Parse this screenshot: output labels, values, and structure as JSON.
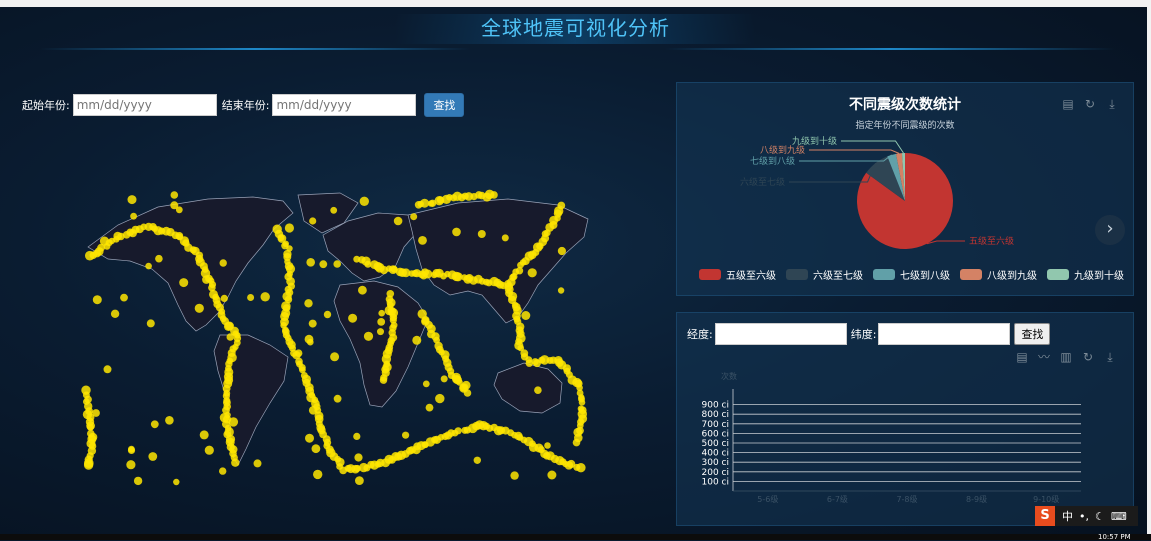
{
  "page": {
    "title": "全球地震可视化分析"
  },
  "date_filter": {
    "start_label": "起始年份:",
    "start_placeholder": "mm/dd/yyyy",
    "end_label": "结束年份:",
    "end_placeholder": "mm/dd/yyyy",
    "search_label": "查找"
  },
  "pie_panel": {
    "title": "不同震级次数统计",
    "subtitle": "指定年份不同震级的次数",
    "tools": [
      "data-view-icon",
      "refresh-icon",
      "download-icon"
    ],
    "next_label": "›"
  },
  "chart_data": [
    {
      "type": "pie",
      "title": "不同震级次数统计",
      "subtitle": "指定年份不同震级的次数",
      "categories": [
        "五级至六级",
        "六级至七级",
        "七级到八级",
        "八级到九级",
        "九级到十级"
      ],
      "values": [
        85,
        9,
        3,
        2,
        1
      ],
      "colors": [
        "#c23531",
        "#2f4554",
        "#61a0a8",
        "#d48265",
        "#91c7ae"
      ],
      "legend_position": "bottom"
    },
    {
      "type": "bar",
      "categories": [
        "5-6级",
        "6-7级",
        "7-8级",
        "8-9级",
        "9-10级"
      ],
      "values": [],
      "ylabel": "次数",
      "y_ticks": [
        "100 ci",
        "200 ci",
        "300 ci",
        "400 ci",
        "500 ci",
        "600 ci",
        "700 ci",
        "800 ci",
        "900 ci"
      ],
      "ylim": [
        0,
        1000
      ],
      "grid": true
    }
  ],
  "coord_panel": {
    "lng_label": "经度:",
    "lat_label": "纬度:",
    "search_label": "查找",
    "tools": [
      "data-view-icon",
      "line-chart-icon",
      "bar-chart-icon",
      "refresh-icon",
      "download-icon"
    ]
  },
  "taskbar": {
    "ime_logo": "S",
    "ime_mode": "中",
    "clock": "10:57 PM"
  },
  "colors": {
    "accent": "#4fc3f7",
    "quake_points": "#ffe600",
    "land": "#171a2c",
    "button": "#337ab7"
  }
}
